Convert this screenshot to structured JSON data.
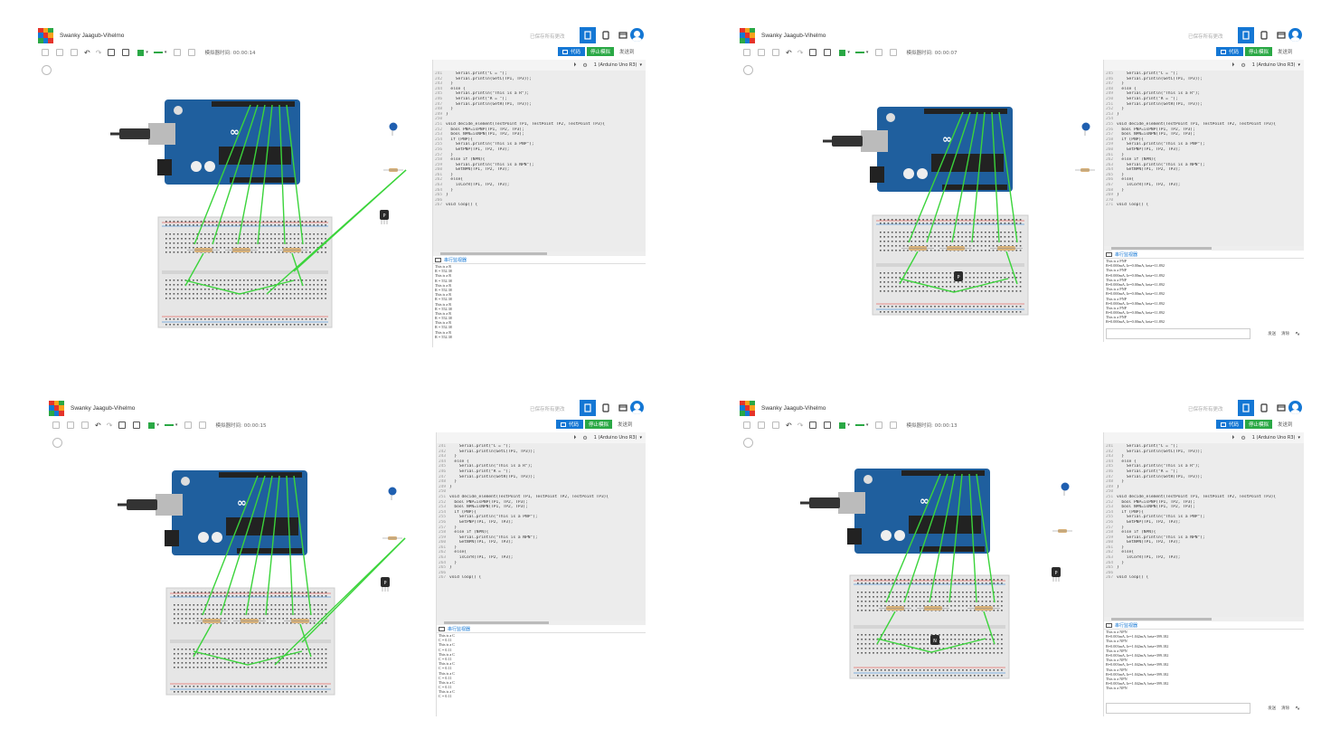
{
  "app": {
    "project_title": "Swanky Jaagub-Vihelmo",
    "saved_status": "已保存所有更改",
    "code_button": "代码",
    "stop_button": "停止模拟",
    "send_button": "发送到",
    "serial_monitor_label": "串行监视器",
    "device_select": "1 (Arduino Uno R3)",
    "sim_time_label": "模拟器时间:",
    "serial_send_label": "发送",
    "serial_clear_label": "清除",
    "colors": {
      "accent": "#1477d4",
      "green": "#2aa845",
      "wire": "#3bd43b",
      "board": "#1f5f9e",
      "breadboard": "#e6e6e6"
    },
    "logo_letters": [
      "TIN",
      "KER",
      "CAD"
    ]
  },
  "screens": [
    {
      "id": "p1",
      "sim_time": "00:00:14",
      "line_start": 241,
      "code_lines": [
        "    Serial.print(\"C = \");",
        "    Serial.println(GetC(TP1, TP3));",
        "  }",
        "  else {",
        "    Serial.println(\"This is a R\");",
        "    Serial.print(\"R = \");",
        "    Serial.println(GetR(TP1, TP3));",
        "  }",
        "}",
        "",
        "void decide_element(TestPoint TP1, TestPoint TP2, TestPoint TP3){",
        "  bool PNP=isPNP(TP1, TP2, TP3);",
        "  bool NPN=isNPN(TP1, TP2, TP3);",
        "  if (PNP){",
        "    Serial.println(\"This is a PNP\");",
        "    GetPNP(TP1, TP2, TP3);",
        "  }",
        "  else if (NPN){",
        "    Serial.println(\"This is a NPN\");",
        "    GetNPN(TP1, TP2, TP3);",
        "  }",
        "  else{",
        "    isCorR(TP1, TP2, TP3);",
        "  }",
        "}",
        "",
        "void loop() {"
      ],
      "serial_lines": [
        "This is a R",
        "R = 552.38",
        "This is a R",
        "R = 552.38",
        "This is a R",
        "R = 552.38",
        "This is a R",
        "R = 552.38",
        "This is a R",
        "R = 552.38",
        "This is a R",
        "R = 552.38",
        "This is a R",
        "R = 552.38",
        "This is a R",
        "R = 552.38"
      ],
      "transistor_label": "P",
      "breadboard_transistor": ""
    },
    {
      "id": "p2",
      "sim_time": "00:00:07",
      "line_start": 245,
      "code_lines": [
        "    Serial.print(\"C = \");",
        "    Serial.println(GetC(TP1, TP3));",
        "  }",
        "  else {",
        "    Serial.println(\"This is a R\");",
        "    Serial.print(\"R = \");",
        "    Serial.println(GetR(TP1, TP3));",
        "  }",
        "}",
        "",
        "void decide_element(TestPoint TP1, TestPoint TP2, TestPoint TP3){",
        "  bool PNP=isPNP(TP1, TP2, TP3);",
        "  bool NPN=isNPN(TP1, TP2, TP3);",
        "  if (PNP){",
        "    Serial.println(\"This is a PNP\");",
        "    GetPNP(TP1, TP2, TP3);",
        "  }",
        "  else if (NPN){",
        "    Serial.println(\"This is a NPN\");",
        "    GetNPN(TP1, TP2, TP3);",
        "  }",
        "  else{",
        "    isCorR(TP1, TP2, TP3);",
        "  }",
        "}",
        "",
        "void loop() {"
      ],
      "serial_lines": [
        "This is a PNP",
        "B=0.000mA, Ie=0.00mA, beta=11.892",
        "This is a PNP",
        "B=0.000mA, Ie=0.00mA, beta=11.892",
        "This is a PNP",
        "B=0.000mA, Ie=0.00mA, beta=11.892",
        "This is a PNP",
        "B=0.000mA, Ie=0.00mA, beta=11.892",
        "This is a PNP",
        "B=0.000mA, Ie=0.00mA, beta=11.892",
        "This is a PNP",
        "B=0.000mA, Ie=0.00mA, beta=11.892",
        "This is a PNP",
        "B=0.000mA, Ie=0.00mA, beta=11.892"
      ],
      "transistor_label": "",
      "breadboard_transistor": "P"
    },
    {
      "id": "p3",
      "sim_time": "00:00:15",
      "line_start": 241,
      "code_lines": [
        "    Serial.print(\"C = \");",
        "    Serial.println(GetC(TP1, TP3));",
        "  }",
        "  else {",
        "    Serial.println(\"This is a R\");",
        "    Serial.print(\"R = \");",
        "    Serial.println(GetR(TP1, TP3));",
        "  }",
        "}",
        "",
        "void decide_element(TestPoint TP1, TestPoint TP2, TestPoint TP3){",
        "  bool PNP=isPNP(TP1, TP2, TP3);",
        "  bool NPN=isNPN(TP1, TP2, TP3);",
        "  if (PNP){",
        "    Serial.println(\"This is a PNP\");",
        "    GetPNP(TP1, TP2, TP3);",
        "  }",
        "  else if (NPN){",
        "    Serial.println(\"This is a NPN\");",
        "    GetNPN(TP1, TP2, TP3);",
        "  }",
        "  else{",
        "    isCorR(TP1, TP2, TP3);",
        "  }",
        "}",
        "",
        "void loop() {"
      ],
      "serial_lines": [
        "This is a C",
        "C = 0.11",
        "This is a C",
        "C = 0.11",
        "This is a C",
        "C = 0.11",
        "This is a C",
        "C = 0.11",
        "This is a C",
        "C = 0.11",
        "This is a C",
        "C = 0.11",
        "This is a C",
        "C = 0.11"
      ],
      "transistor_label": "P",
      "breadboard_transistor": ""
    },
    {
      "id": "p4",
      "sim_time": "00:00:13",
      "line_start": 241,
      "code_lines": [
        "    Serial.print(\"C = \");",
        "    Serial.println(GetC(TP1, TP3));",
        "  }",
        "  else {",
        "    Serial.println(\"This is a R\");",
        "    Serial.print(\"R = \");",
        "    Serial.println(GetR(TP1, TP3));",
        "  }",
        "}",
        "",
        "void decide_element(TestPoint TP1, TestPoint TP2, TestPoint TP3){",
        "  bool PNP=isPNP(TP1, TP2, TP3);",
        "  bool NPN=isNPN(TP1, TP2, TP3);",
        "  if (PNP){",
        "    Serial.println(\"This is a PNP\");",
        "    GetPNP(TP1, TP2, TP3);",
        "  }",
        "  else if (NPN){",
        "    Serial.println(\"This is a NPN\");",
        "    GetNPN(TP1, TP2, TP3);",
        "  }",
        "  else{",
        "    isCorR(TP1, TP2, TP3);",
        "  }",
        "}",
        "",
        "void loop() {"
      ],
      "serial_lines": [
        "This is a NPN",
        "B=0.003mA, Ie=1.042mA, beta=399.182",
        "This is a NPN",
        "B=0.003mA, Ie=1.042mA, beta=399.182",
        "This is a NPN",
        "B=0.003mA, Ie=1.042mA, beta=399.182",
        "This is a NPN",
        "B=0.003mA, Ie=1.042mA, beta=399.182",
        "This is a NPN",
        "B=0.003mA, Ie=1.042mA, beta=399.182",
        "This is a NPN",
        "B=0.003mA, Ie=1.042mA, beta=399.182",
        "This is a NPN"
      ],
      "transistor_label": "P",
      "breadboard_transistor": "N"
    }
  ]
}
